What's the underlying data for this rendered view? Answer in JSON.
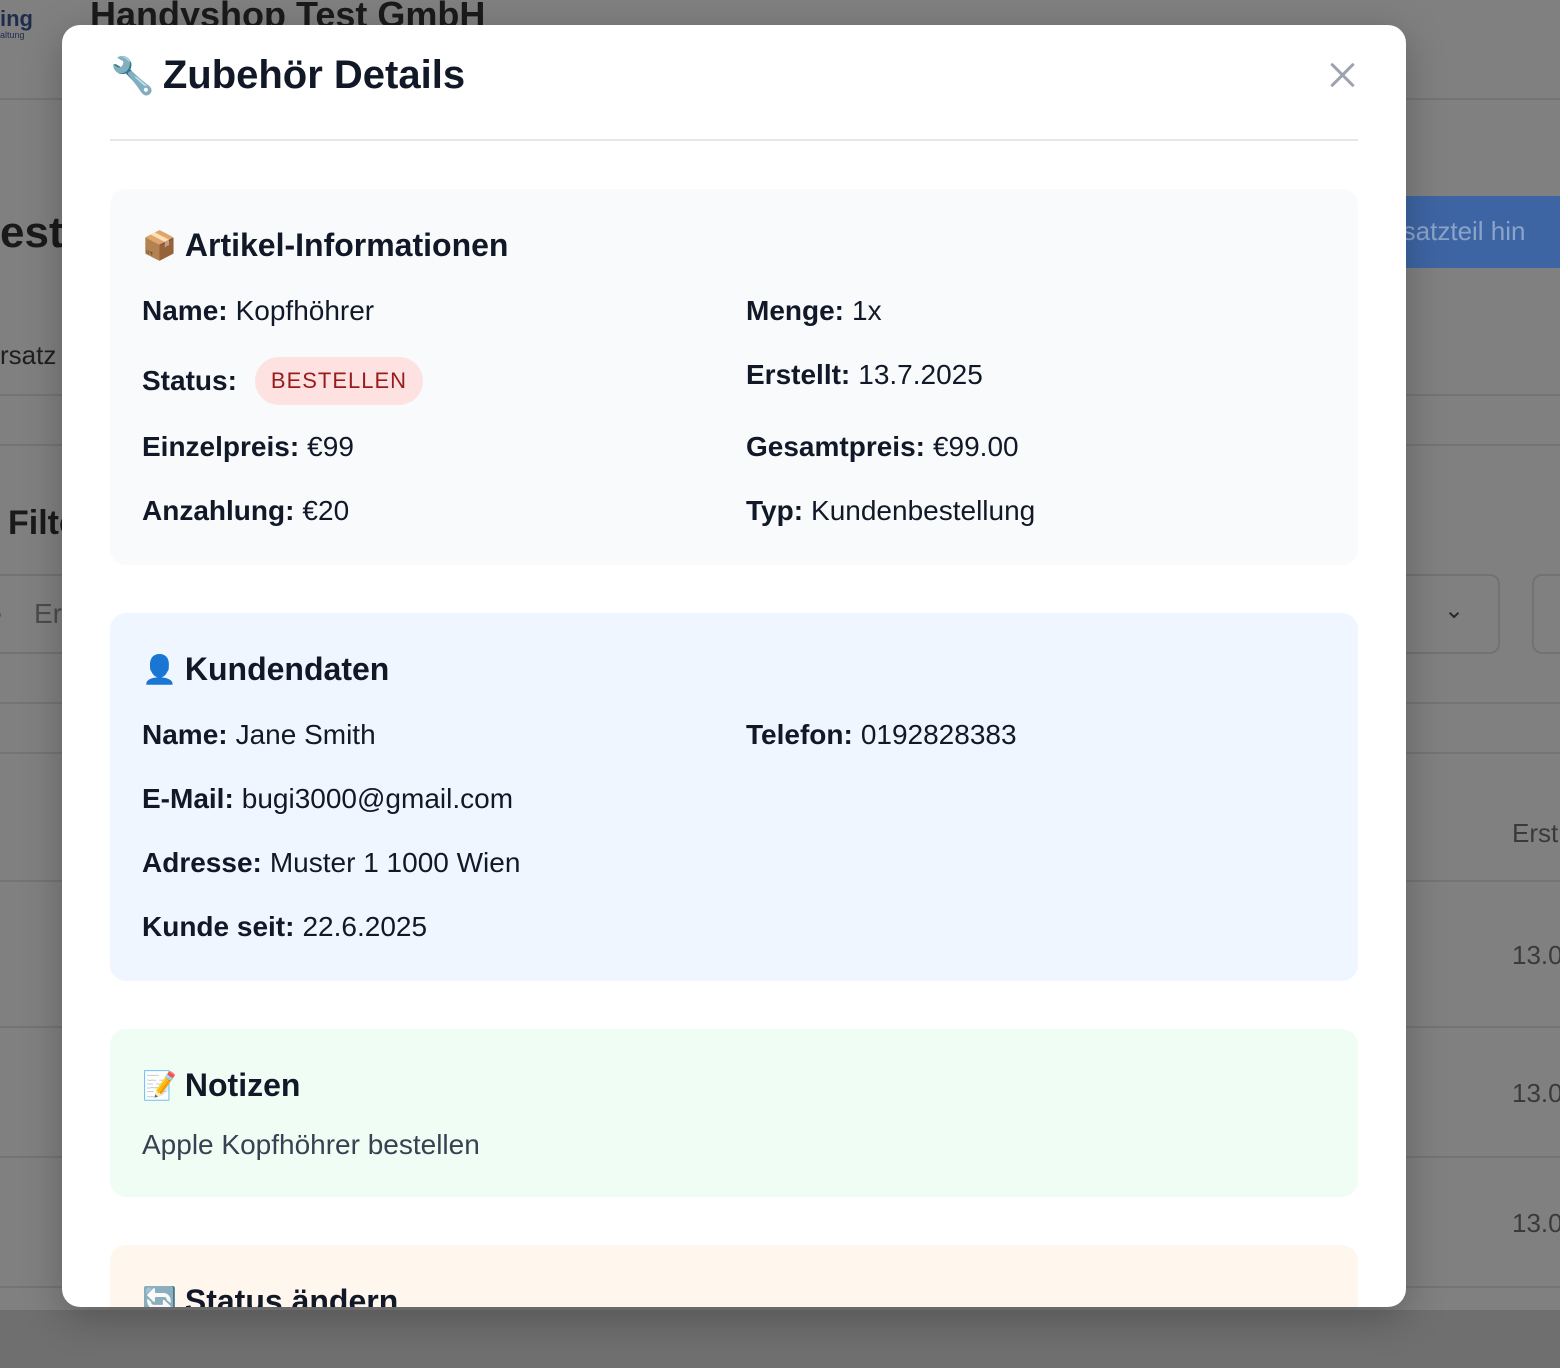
{
  "background": {
    "logo_line1": "ing",
    "logo_line2": "altung",
    "company": "Handyshop Test GmbH",
    "heading": "est",
    "add_button": "rsatzteil hin",
    "tab": "rsatz",
    "filter_heading": "Filte",
    "search_placeholder": "Er",
    "column_header": "Erst",
    "dates": [
      "13.0",
      "13.0",
      "13.0"
    ]
  },
  "modal": {
    "title_emoji": "🔧",
    "title": "Zubehör Details",
    "close_label": "×"
  },
  "article": {
    "emoji": "📦",
    "title": "Artikel-Informationen",
    "name_label": "Name:",
    "name": "Kopfhöhrer",
    "quantity_label": "Menge:",
    "quantity": "1x",
    "status_label": "Status:",
    "status": "BESTELLEN",
    "created_label": "Erstellt:",
    "created": "13.7.2025",
    "unit_price_label": "Einzelpreis:",
    "unit_price": "€99",
    "total_price_label": "Gesamtpreis:",
    "total_price": "€99.00",
    "deposit_label": "Anzahlung:",
    "deposit": "€20",
    "type_label": "Typ:",
    "type": "Kundenbestellung"
  },
  "customer": {
    "emoji": "👤",
    "title": "Kundendaten",
    "name_label": "Name:",
    "name": "Jane Smith",
    "phone_label": "Telefon:",
    "phone": "0192828383",
    "email_label": "E-Mail:",
    "email": "bugi3000@gmail.com",
    "address_label": "Adresse:",
    "address": "Muster 1 1000 Wien",
    "since_label": "Kunde seit:",
    "since": "22.6.2025"
  },
  "notes": {
    "emoji": "📝",
    "title": "Notizen",
    "text": "Apple Kopfhöhrer bestellen"
  },
  "status_change": {
    "emoji": "🔄",
    "title": "Status ändern"
  },
  "colors": {
    "overlay": "#808080",
    "badge_bg": "#fee2e2",
    "badge_text": "#991b1b",
    "article_bg": "#f8fafc",
    "customer_bg": "#eff6ff",
    "notes_bg": "#f0fdf4",
    "status_bg": "#fff7ed"
  }
}
